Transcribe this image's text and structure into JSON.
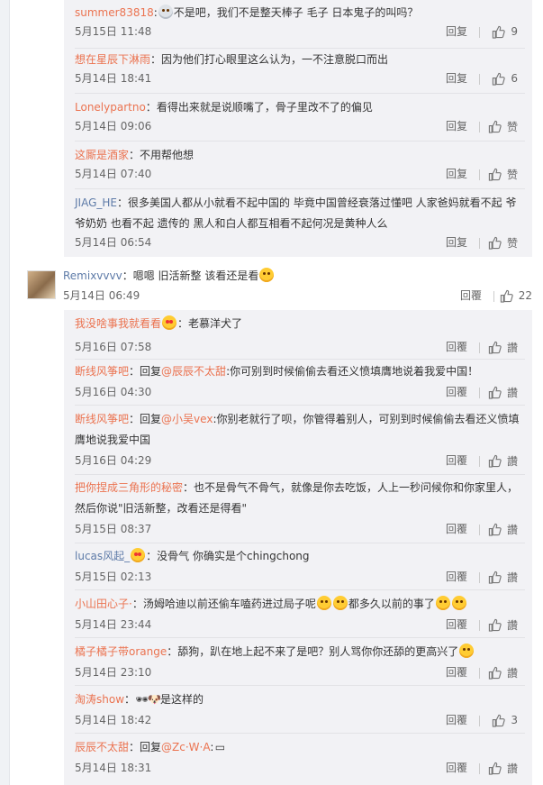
{
  "box1": [
    {
      "user": "summer83818",
      "content": "不是吧，我们不是整天棒子 毛子 日本鬼子的叫吗？",
      "time": "5月15日 11:48",
      "reply": "回复",
      "likes": "9"
    },
    {
      "user": "想在星辰下淋雨",
      "content": "因为他们打心眼里这么认为，一不注意脱口而出",
      "time": "5月14日 18:41",
      "reply": "回复",
      "likes": "6"
    },
    {
      "user": "Lonelypartno",
      "content": "看得出来就是说顺嘴了，骨子里改不了的偏见",
      "time": "5月14日 09:06",
      "reply": "回复",
      "likes": "赞"
    },
    {
      "user": "这厮是酒家",
      "content": "不用帮他想",
      "time": "5月14日 07:40",
      "reply": "回复",
      "likes": "赞"
    },
    {
      "user": "JIAG_HE",
      "content": "很多美国人都从小就看不起中国的 毕竟中国曾经衰落过懂吧 人家爸妈就看不起 爷爷奶奶 也看不起 遗传的 黑人和白人都互相看不起何况是黄种人么",
      "time": "5月14日 06:54",
      "reply": "回复",
      "likes": "赞"
    }
  ],
  "main": {
    "user": "Remixvvvv",
    "content": "嗯嗯 旧活新整 该看还是看",
    "time": "5月14日 06:49",
    "reply": "回覆",
    "likes": "22"
  },
  "box2": [
    {
      "user": "我没啥事我就看看",
      "content": "老慕洋犬了",
      "time": "5月16日 07:58",
      "reply": "回覆",
      "likes": "讚"
    },
    {
      "user": "断线风筝吧",
      "pre": "回复",
      "mention": "@辰辰不太甜",
      "content": ":你可别到时候偷偷去看还义愤填膺地说着我爱中国！",
      "time": "5月16日 04:30",
      "reply": "回覆",
      "likes": "讚"
    },
    {
      "user": "断线风筝吧",
      "pre": "回复",
      "mention": "@小吴vex",
      "content": ":你别老就行了呗，你管得着别人，可别到时候偷偷去看还义愤填膺地说我爱中国",
      "time": "5月16日 04:29",
      "reply": "回覆",
      "likes": "讚"
    },
    {
      "user": "把你捏成三角形的秘密",
      "content": "也不是骨气不骨气，就像是你去吃饭，人上一秒问候你和你家里人，然后你说\"旧活新整，改看还是得看\"",
      "time": "5月15日 08:37",
      "reply": "回覆",
      "likes": "讚"
    },
    {
      "user": "lucas风起_",
      "content": "没骨气 你确实是个chingchong",
      "time": "5月15日 02:13",
      "reply": "回覆",
      "likes": "讚"
    },
    {
      "user": "小山田心子·",
      "content": "汤姆哈迪以前还偷车嗑药进过局子呢",
      "content2": "都多久以前的事了",
      "time": "5月14日 23:44",
      "reply": "回覆",
      "likes": "讚"
    },
    {
      "user": "橘子橘子带orange",
      "content": "舔狗，趴在地上起不来了是吧？别人骂你你还舔的更高兴了",
      "time": "5月14日 23:10",
      "reply": "回覆",
      "likes": "讚"
    },
    {
      "user": "淘涛show",
      "content": "是这样的",
      "time": "5月14日 18:42",
      "reply": "回覆",
      "likes": "3"
    },
    {
      "user": "辰辰不太甜",
      "pre": "回复",
      "mention": "@Zc·W·A",
      "content": ":",
      "time": "5月14日 18:31",
      "reply": "回覆",
      "likes": "讚"
    }
  ]
}
